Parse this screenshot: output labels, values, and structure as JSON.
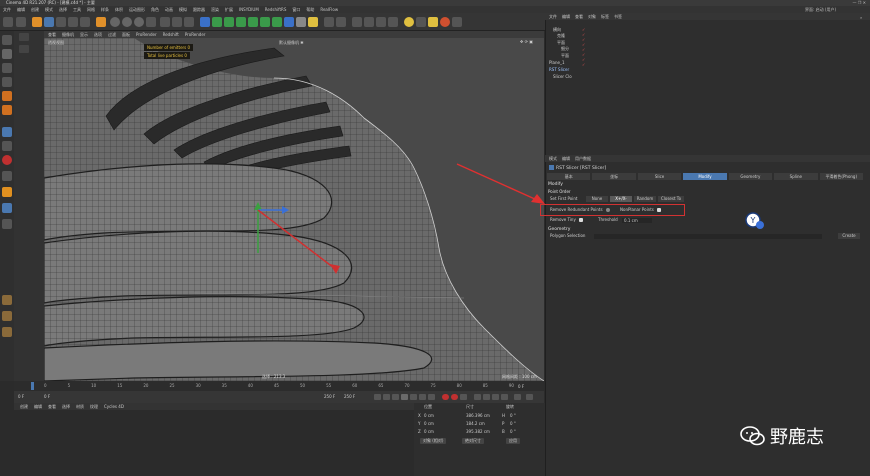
{
  "titlebar": {
    "title": "Cinema 4D R21.207 (RC) - [建模.c4d *] - 主要",
    "controls": "—  ❐  ✕"
  },
  "topright": {
    "layout_label": "界面: 启动 (用户)"
  },
  "menubar": [
    "文件",
    "编辑",
    "创建",
    "模式",
    "选择",
    "工具",
    "网格",
    "样条",
    "体积",
    "运动图形",
    "角色",
    "动画",
    "模拟",
    "跟踪器",
    "渲染",
    "扩展",
    "INSYDIUM",
    "RedshiftRS",
    "窗口",
    "帮助",
    "RealFlow"
  ],
  "viewport_menu": [
    "查看",
    "摄像机",
    "显示",
    "选项",
    "过滤",
    "面板",
    "ProRender",
    "Redshift",
    "ProRender"
  ],
  "viewport": {
    "label": "透视视图",
    "camera": "默认摄像机 ✱",
    "hud_line1": "Number of emitters 0",
    "hud_line2": "Total live particles 0",
    "grid_spacing": "网格间距 : 100 cm",
    "selection": "选择 : 213.3"
  },
  "timeline": {
    "ticks": [
      "0",
      "5",
      "10",
      "15",
      "20",
      "25",
      "30",
      "35",
      "40",
      "45",
      "50",
      "55",
      "60",
      "65",
      "70",
      "75",
      "80",
      "85",
      "90"
    ],
    "end_frame": "0 F"
  },
  "playbar": {
    "current": "0 F",
    "start": "0 F",
    "end": "250 F",
    "end2": "250 F"
  },
  "anim_menu": [
    "创建",
    "编辑",
    "查看",
    "选择",
    "材质",
    "纹理",
    "Cycles 4D"
  ],
  "coords": {
    "headers": [
      "位置",
      "尺寸",
      "旋转"
    ],
    "rows": [
      {
        "axis": "X",
        "pos": "0 cm",
        "size": "386.396 cm",
        "rot_axis": "H",
        "rot": "0 °"
      },
      {
        "axis": "Y",
        "pos": "0 cm",
        "size": "184.2 cm",
        "rot_axis": "P",
        "rot": "0 °"
      },
      {
        "axis": "Z",
        "pos": "0 cm",
        "size": "395.382 cm",
        "rot_axis": "B",
        "rot": "0 °"
      }
    ],
    "mode_select": "对象 (相对)",
    "size_select": "绝对尺寸",
    "apply": "应用"
  },
  "objmgr": {
    "menu": [
      "文件",
      "编辑",
      "查看",
      "对象",
      "标签",
      "书签"
    ],
    "items": [
      {
        "name": "横向",
        "indent": 1
      },
      {
        "name": "克隆",
        "indent": 2
      },
      {
        "name": "平面",
        "indent": 2
      },
      {
        "name": "细分",
        "indent": 3
      },
      {
        "name": "平面",
        "indent": 3
      },
      {
        "name": "Plane_1",
        "indent": 0
      },
      {
        "name": "RST Slicer",
        "indent": 0,
        "selected": true
      },
      {
        "name": "Slicer Clo",
        "indent": 1
      }
    ]
  },
  "attrmgr": {
    "menu": [
      "模式",
      "编辑",
      "用户数据"
    ],
    "object_title": "RST Slicer [RST Slicer]",
    "tabs": [
      "基本",
      "坐标",
      "Slice",
      "Modify",
      "Geometry",
      "Spline",
      "平滑着色(Phong)"
    ],
    "active_tab": "Modify",
    "section_modify": "Modify",
    "sub_point_order": "Point Order",
    "set_first_point": "Set First Point",
    "point_order_options": [
      "None",
      "X+/X-",
      "Random",
      "Closest To"
    ],
    "point_order_active": "X+/X-",
    "remove_redundant": "Remove Redundant Points",
    "non_planar": "NonPlanar Points",
    "remove_tiny": "Remove Tiny",
    "threshold_label": "Threshold",
    "threshold_value": "0.1 cm",
    "section_geometry": "Geometry",
    "polygon_selection": "Polygon Selection",
    "create_button": "Create"
  },
  "watermark": {
    "text": "野鹿志"
  },
  "colors": {
    "accent": "#4a78b0",
    "highlight_box": "#d23232",
    "hud_text": "#e6c040"
  }
}
